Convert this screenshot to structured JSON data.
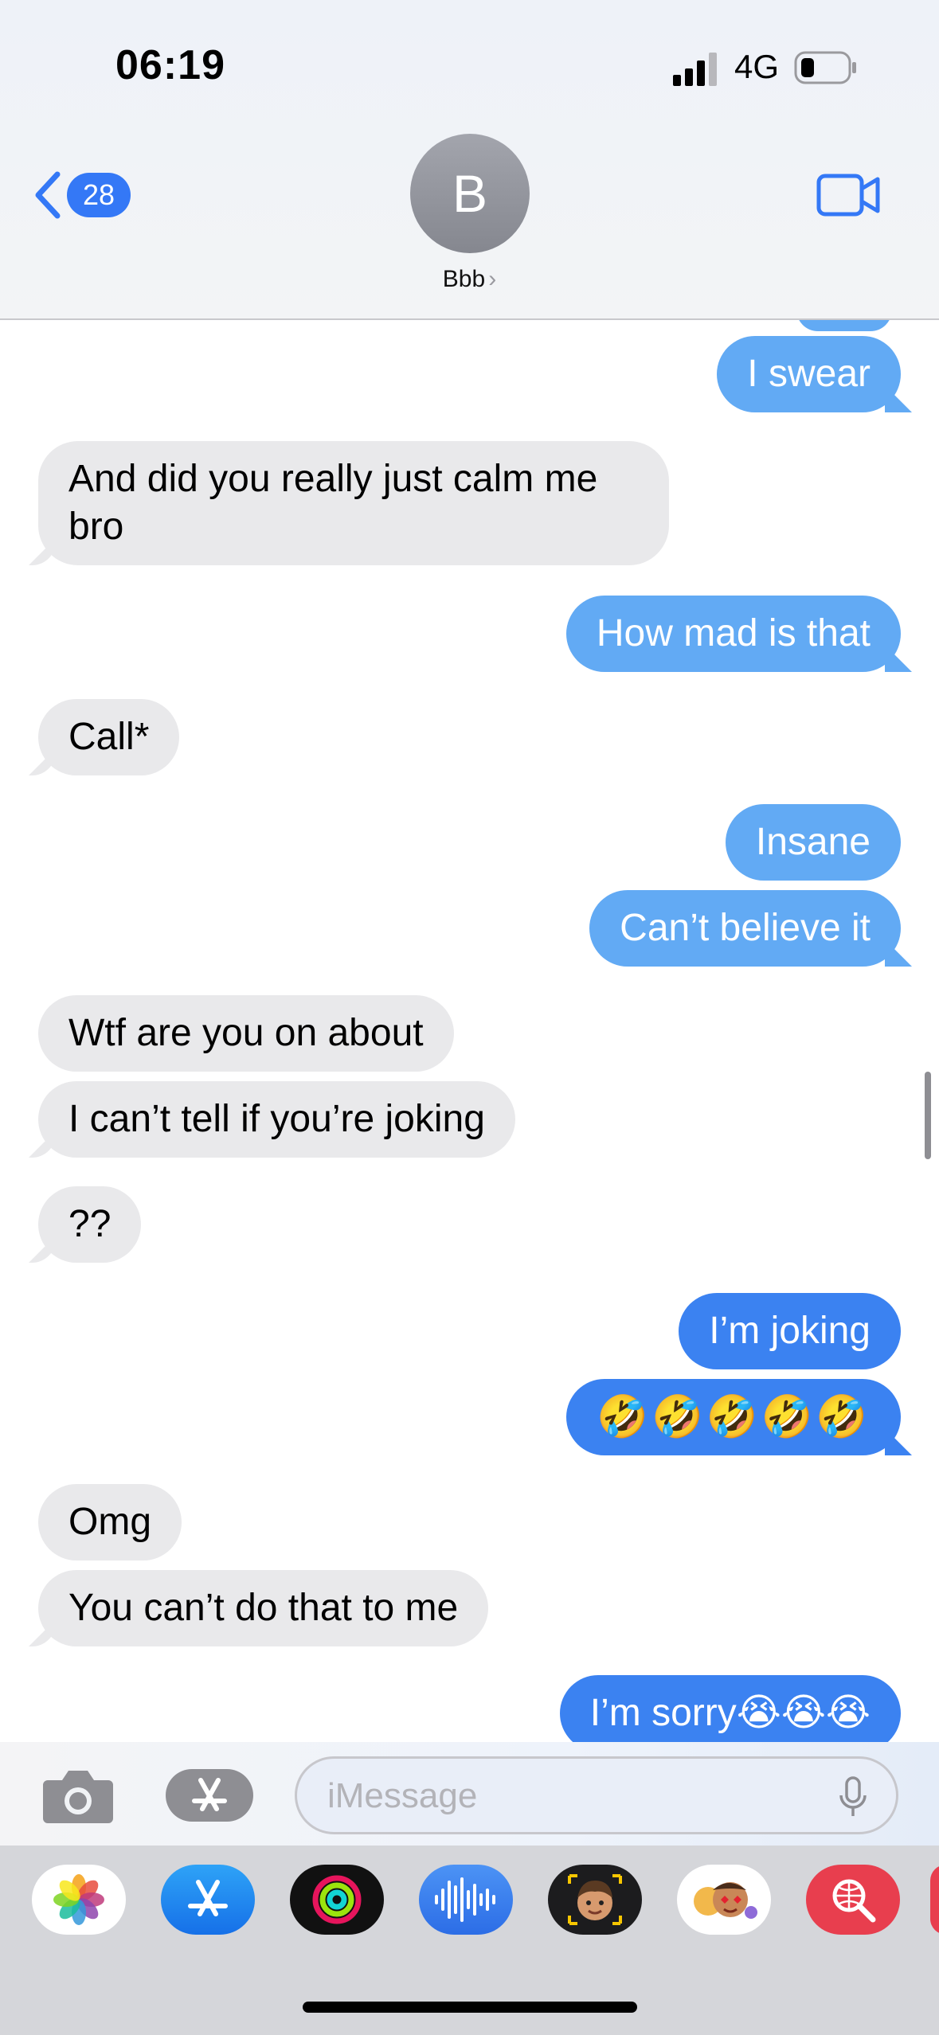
{
  "status_bar": {
    "time": "06:19",
    "network": "4G"
  },
  "header": {
    "back_count": "28",
    "avatar_initial": "B",
    "contact_name": "Bbb",
    "chevron": "›"
  },
  "messages": [
    {
      "text": "I swear",
      "from": "me"
    },
    {
      "text": "And did you really just calm me",
      "text2": "bro",
      "from": "them"
    },
    {
      "text": "How mad is that",
      "from": "me"
    },
    {
      "text": "Call*",
      "from": "them"
    },
    {
      "text": "Insane",
      "from": "me"
    },
    {
      "text": "Can’t believe it",
      "from": "me"
    },
    {
      "text": "Wtf are you on about",
      "from": "them"
    },
    {
      "text": "I can’t tell if you’re joking",
      "from": "them"
    },
    {
      "text": "??",
      "from": "them"
    },
    {
      "text": "I’m joking",
      "from": "me"
    },
    {
      "text": "🤣🤣🤣🤣🤣",
      "from": "me"
    },
    {
      "text": "Omg",
      "from": "them"
    },
    {
      "text": "You can’t do that to me",
      "from": "them"
    },
    {
      "text": "I’m sorry😭😭😭",
      "from": "me"
    }
  ],
  "input": {
    "placeholder": "iMessage"
  },
  "app_strip": [
    {
      "icon": "photos-icon"
    },
    {
      "icon": "app-store-icon"
    },
    {
      "icon": "activity-icon"
    },
    {
      "icon": "audio-message-icon"
    },
    {
      "icon": "memoji-icon"
    },
    {
      "icon": "memoji-stickers-icon"
    },
    {
      "icon": "web-search-icon"
    }
  ],
  "colors": {
    "outgoing": "#62aaf4",
    "outgoing_latest": "#3b82f1",
    "incoming": "#e9e9eb",
    "accent": "#3478f6"
  }
}
